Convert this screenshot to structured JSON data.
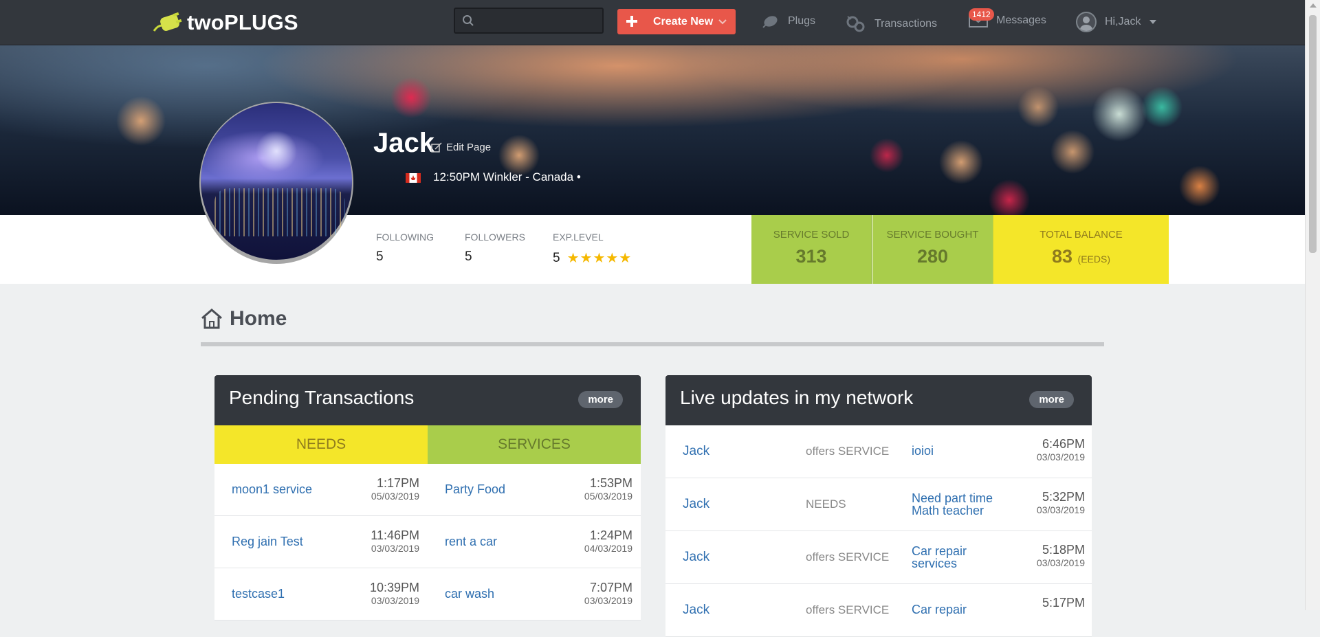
{
  "app": {
    "logo_text": "twoPLUGS"
  },
  "nav": {
    "search_placeholder": "",
    "create_label": "Create New",
    "plugs": "Plugs",
    "transactions": "Transactions",
    "messages": "Messages",
    "messages_badge": "1412",
    "user_greeting": "Hi,Jack"
  },
  "profile": {
    "name": "Jack",
    "edit_label": "Edit Page",
    "location": "12:50PM Winkler - Canada •",
    "following_label": "FOLLOWING",
    "following": "5",
    "followers_label": "FOLLOWERS",
    "followers": "5",
    "exp_label": "EXP.LEVEL",
    "exp": "5",
    "stars": "★★★★★",
    "exp_stars_value": 5
  },
  "tiles": {
    "sold_label": "SERVICE SOLD",
    "sold": "313",
    "bought_label": "SERVICE BOUGHT",
    "bought": "280",
    "balance_label": "TOTAL BALANCE",
    "balance": "83",
    "balance_unit": "(EEDS)"
  },
  "home": {
    "title": "Home"
  },
  "pending": {
    "title": "Pending Transactions",
    "more": "more",
    "needs_label": "NEEDS",
    "services_label": "SERVICES",
    "rows": [
      {
        "need": "moon1 service",
        "need_time": "1:17PM",
        "need_date": "05/03/2019",
        "service": "Party Food",
        "service_time": "1:53PM",
        "service_date": "05/03/2019"
      },
      {
        "need": "Reg jain Test",
        "need_time": "11:46PM",
        "need_date": "03/03/2019",
        "service": "rent a car",
        "service_time": "1:24PM",
        "service_date": "04/03/2019"
      },
      {
        "need": "testcase1",
        "need_time": "10:39PM",
        "need_date": "03/03/2019",
        "service": "car wash",
        "service_time": "7:07PM",
        "service_date": "03/03/2019"
      }
    ]
  },
  "live": {
    "title": "Live updates in my network",
    "more": "more",
    "rows": [
      {
        "who": "Jack",
        "action": "offers SERVICE",
        "item": "ioioi",
        "time": "6:46PM",
        "date": "03/03/2019"
      },
      {
        "who": "Jack",
        "action": "NEEDS",
        "item": "Need part time Math teacher",
        "time": "5:32PM",
        "date": "03/03/2019"
      },
      {
        "who": "Jack",
        "action": "offers SERVICE",
        "item": "Car repair services",
        "time": "5:18PM",
        "date": "03/03/2019"
      },
      {
        "who": "Jack",
        "action": "offers SERVICE",
        "item": "Car repair",
        "time": "5:17PM",
        "date": ""
      }
    ]
  },
  "colors": {
    "accent": "#e8574a",
    "nav_bg": "#33373d",
    "green": "#a9cd4b",
    "yellow": "#f4e629",
    "link": "#2f6fb0"
  }
}
